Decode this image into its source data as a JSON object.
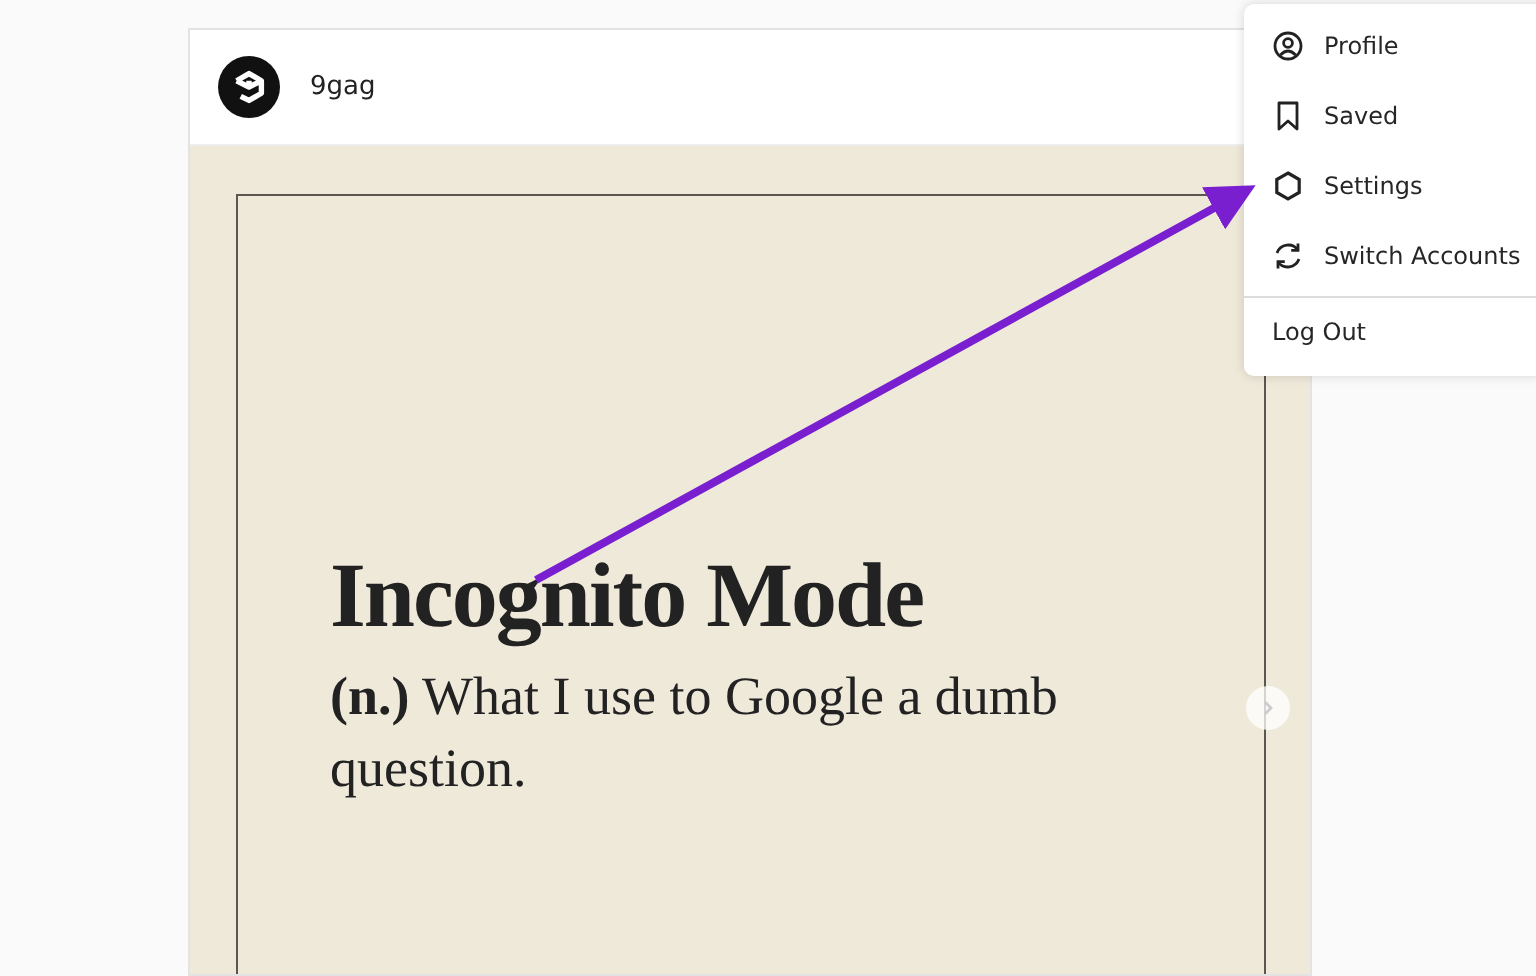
{
  "post": {
    "username": "9gag",
    "image": {
      "title": "Incognito Mode",
      "definition": "**(n.)** What I use to Google a dumb question."
    }
  },
  "menu": {
    "items": [
      {
        "label": "Profile"
      },
      {
        "label": "Saved"
      },
      {
        "label": "Settings"
      },
      {
        "label": "Switch Accounts"
      }
    ],
    "footer": "Log Out"
  }
}
